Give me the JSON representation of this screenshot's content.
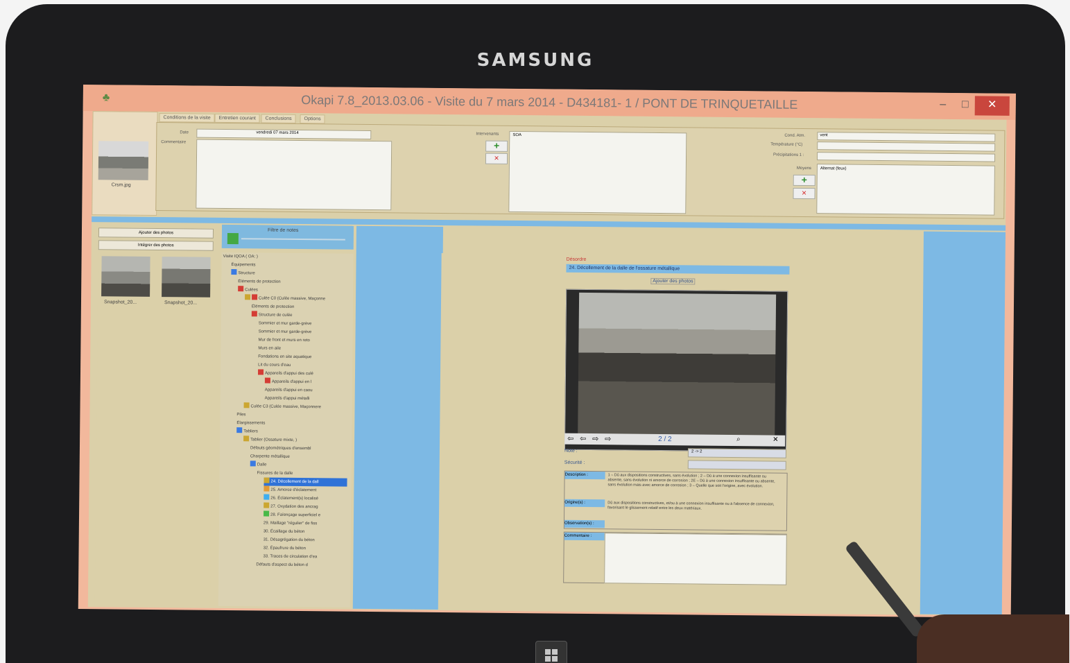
{
  "device": {
    "brand": "SAMSUNG"
  },
  "window": {
    "title": "Okapi 7.8_2013.03.06 - Visite du 7 mars 2014 - D434181- 1 / PONT DE TRINQUETAILLE",
    "minimize": "–",
    "maximize": "□",
    "close": "✕"
  },
  "left_thumb": {
    "filename": "Crsm.jpg"
  },
  "tabs": [
    "Conditions de la visite",
    "Entretien courant",
    "Conclusions",
    "Options"
  ],
  "conditions": {
    "date_label": "Date",
    "date_value": "vendredi 07 mars 2014",
    "comment_label": "Commentaire",
    "intervenants_label": "Intervenants",
    "intervenants_value": "SOA",
    "cond_atm_label": "Cond. Atm.",
    "cond_atm_value": "vent",
    "temperature_label": "Température (°C)",
    "precipitations_label": "Précipitations 1 :",
    "moyens_label": "Moyens",
    "moyens_value": "Alternat (feux)"
  },
  "photos_panel": {
    "add_button": "Ajouter des photos",
    "remove_button": "Intégrer des photos",
    "thumbnails": [
      "Snapshot_20...",
      "Snapshot_20..."
    ]
  },
  "filter": {
    "label": "Filtre de notes"
  },
  "tree": {
    "rows": [
      "Visite IQOA ( OA: )",
      "Équipements",
      "Structure",
      "Éléments de protection",
      "Culées",
      "Culée C0 (Culée massive, Maçonne",
      "Éléments de protection",
      "Structure de culée",
      "Sommier et mur garde-grève",
      "Sommier et mur garde-grève",
      "Mur de front et murs en reto",
      "Murs en aile",
      "Fondations en site aquatique",
      "Lit du cours d'eau",
      "Appareils d'appui des culé",
      "Appareils d'appui en l",
      "Appareils d'appui en caou",
      "Appareils d'appui métalli",
      "Culée C3 (Culée massive, Maçonnere",
      "Piles",
      "Élargissements",
      "Tabliers",
      "Tablier (Ossature mixte, )",
      "Défauts géométriques d'ensembl",
      "Charpente métallique",
      "Dalle",
      "Fissures de la dalle",
      "24. Décollement de la dall",
      "25. Amorce d'éclatement",
      "26. Éclatement(s) localisé",
      "27. Oxydation des ancrag",
      "28. Faïençage superficiel e",
      "29. Maillage \"régulier\" de fiss",
      "30. Écaillage du béton",
      "31. Désagrégation du béton",
      "32. Épaufrure du béton",
      "33. Traces de circulation d'ea",
      "Défauts d'aspect du béton d"
    ]
  },
  "detail": {
    "section_label": "Désordre",
    "disorder_title": "24. Décollement de la dalle de l'ossature métallique",
    "add_photos": "Ajouter des photos",
    "counter": "2 / 2",
    "note_label": "Note :",
    "note_value": "2 -> 2",
    "securite_label": "Sécurité :",
    "description_label": "Description :",
    "description_text": "1 – Dû aux dispositions constructives, sans évolution ; 2 – Dû à une connexion insuffisante ou absente, sans évolution ni amorce de corrosion ; 2E – Dû à une connexion insuffisante ou absente, sans évolution mais avec amorce de corrosion ; 3 – Quelle que soit l'origine, avec évolution.",
    "origine_label": "Origine(s) :",
    "origine_text": "Dû aux dispositions constructives, et/ou à une connexion insuffisante ou à l'absence de connexion, favorisant le glissement relatif entre les deux matériaux.",
    "observations_label": "Observation(s) :",
    "commentaire_label": "Commentaire :"
  },
  "colors": {
    "title_bar": "#efaa8c",
    "panel": "#dbd0a9",
    "selection": "#7db9e4",
    "close": "#c9463d"
  }
}
